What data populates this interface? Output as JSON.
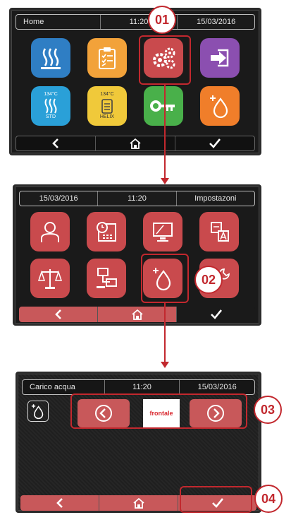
{
  "screen1": {
    "status": {
      "title": "Home",
      "time": "11:20",
      "date": "15/03/2016"
    },
    "tiles": [
      {
        "icon": "heating-icon",
        "color": "#2f7ec4"
      },
      {
        "icon": "checklist-icon",
        "color": "#f2a23a"
      },
      {
        "icon": "gears-icon",
        "color": "#c94a4d"
      },
      {
        "icon": "exit-icon",
        "color": "#8b4fb0"
      },
      {
        "icon": "sterilizer-std-icon",
        "color": "#2aa0d8",
        "top": "134°C",
        "label": "STD"
      },
      {
        "icon": "sterilizer-helix-icon",
        "color": "#f0c93a",
        "top": "134°C",
        "label": "HELIX"
      },
      {
        "icon": "key-icon",
        "color": "#49b04a"
      },
      {
        "icon": "water-drop-icon",
        "color": "#f07e2a"
      }
    ]
  },
  "screen2": {
    "status": {
      "date": "15/03/2016",
      "time": "11:20",
      "title": "Impostazoni"
    },
    "tiles": [
      {
        "icon": "user-icon"
      },
      {
        "icon": "calendar-clock-icon"
      },
      {
        "icon": "monitor-icon"
      },
      {
        "icon": "language-icon"
      },
      {
        "icon": "scale-icon"
      },
      {
        "icon": "network-icon"
      },
      {
        "icon": "water-drop-icon"
      },
      {
        "icon": "tools-icon"
      }
    ]
  },
  "screen3": {
    "status": {
      "title": "Carico acqua",
      "time": "11:20",
      "date": "15/03/2016"
    },
    "selector_value": "frontale"
  },
  "callouts": {
    "c1": "01",
    "c2": "02",
    "c3": "03",
    "c4": "04"
  },
  "colors": {
    "accent": "#c2282e",
    "tile_red": "#c94a4d"
  }
}
